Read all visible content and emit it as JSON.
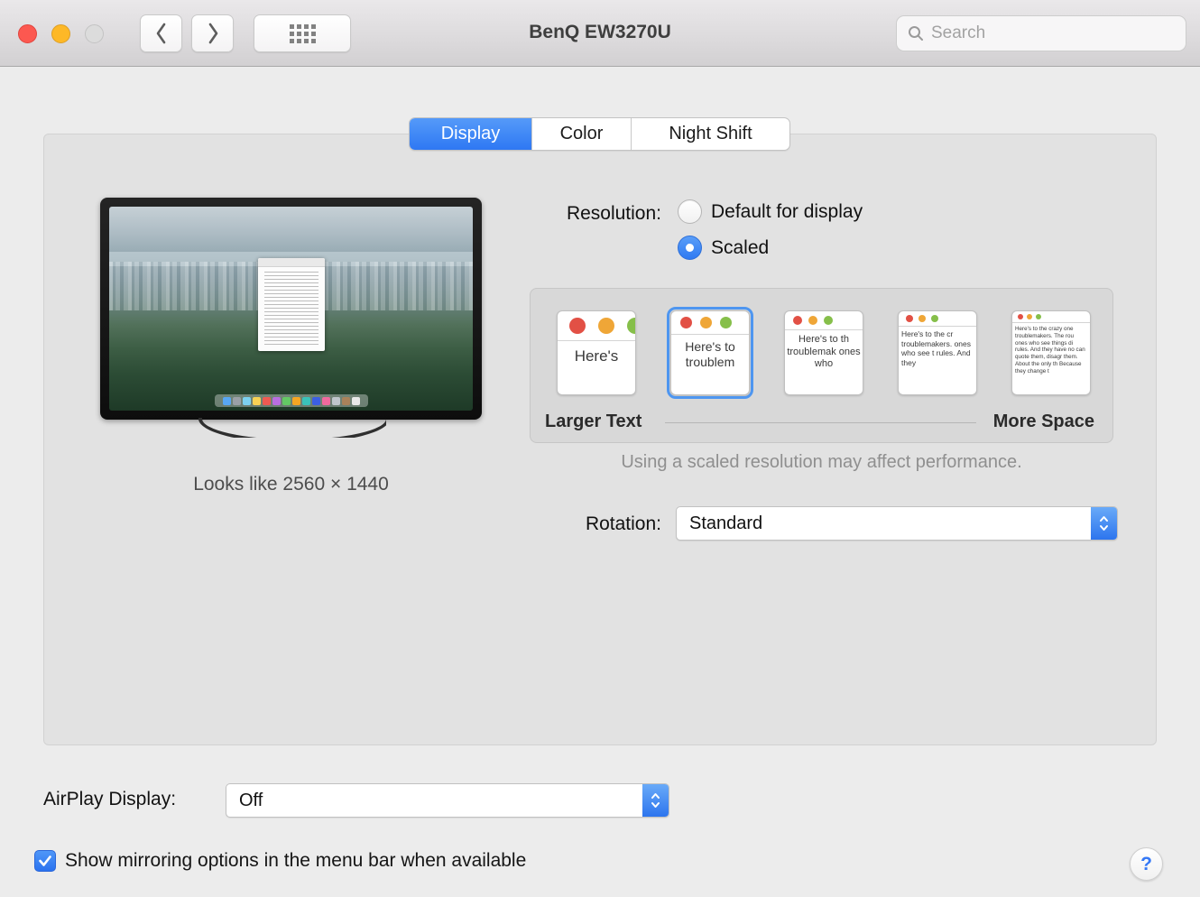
{
  "titlebar": {
    "title": "BenQ EW3270U",
    "search_placeholder": "Search"
  },
  "tabs": {
    "display": "Display",
    "color": "Color",
    "night_shift": "Night Shift"
  },
  "preview": {
    "looks_like": "Looks like 2560 × 1440"
  },
  "resolution": {
    "label": "Resolution:",
    "default_option": "Default for display",
    "scaled_option": "Scaled",
    "selected": "Scaled"
  },
  "scaled": {
    "thumbnails": [
      {
        "text": "Here's"
      },
      {
        "text": "Here's to troublem"
      },
      {
        "text": "Here's to th troublemak ones who"
      },
      {
        "text": "Here's to the cr troublemakers. ones who see t rules. And they"
      },
      {
        "text": "Here's to the crazy one troublemakers. The rou ones who see things di rules. And they have no can quote them, disagr them. About the only th Because they change t"
      }
    ],
    "selected_index": 1,
    "larger_text": "Larger Text",
    "more_space": "More Space",
    "note": "Using a scaled resolution may affect performance."
  },
  "rotation": {
    "label": "Rotation:",
    "value": "Standard"
  },
  "airplay": {
    "label": "AirPlay Display:",
    "value": "Off"
  },
  "mirroring": {
    "label": "Show mirroring options in the menu bar when available",
    "checked": true
  },
  "help_label": "?",
  "colors": {
    "accent_blue": "#2e78f3",
    "selected_thumbnail_ring": "#4e96f0"
  }
}
